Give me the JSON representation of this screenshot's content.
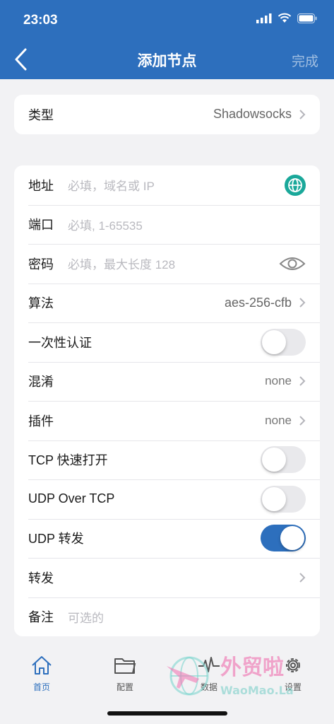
{
  "status": {
    "time": "23:03"
  },
  "nav": {
    "title": "添加节点",
    "done_label": "完成"
  },
  "type_row": {
    "label": "类型",
    "value": "Shadowsocks"
  },
  "form": {
    "address": {
      "label": "地址",
      "placeholder": "必填，域名或 IP"
    },
    "port": {
      "label": "端口",
      "placeholder": "必填, 1-65535"
    },
    "password": {
      "label": "密码",
      "placeholder": "必填，最大长度 128"
    },
    "cipher": {
      "label": "算法",
      "value": "aes-256-cfb"
    },
    "one_time_auth": {
      "label": "一次性认证",
      "enabled": false
    },
    "obfs": {
      "label": "混淆",
      "value": "none"
    },
    "plugin": {
      "label": "插件",
      "value": "none"
    },
    "tcp_fast_open": {
      "label": "TCP 快速打开",
      "enabled": false
    },
    "udp_over_tcp": {
      "label": "UDP Over TCP",
      "enabled": false
    },
    "udp_relay": {
      "label": "UDP 转发",
      "enabled": true
    },
    "relay": {
      "label": "转发"
    },
    "remark": {
      "label": "备注",
      "placeholder": "可选的"
    }
  },
  "tabs": [
    {
      "label": "首页",
      "icon": "home-icon",
      "active": true
    },
    {
      "label": "配置",
      "icon": "folder-icon",
      "active": false
    },
    {
      "label": "数据",
      "icon": "activity-icon",
      "active": false
    },
    {
      "label": "设置",
      "icon": "gear-icon",
      "active": false
    }
  ],
  "watermark": {
    "text": "外贸啦",
    "subtext": "WaoMao.La"
  },
  "colors": {
    "accent": "#2d6fbd",
    "teal": "#1aa89a",
    "background": "#f2f2f4"
  }
}
